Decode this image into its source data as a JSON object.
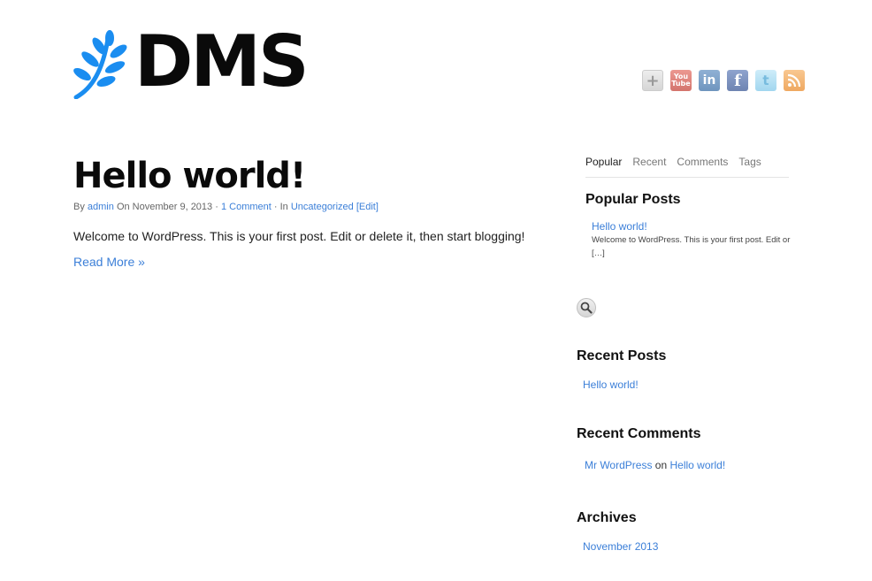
{
  "site": {
    "logo_text": "DMS"
  },
  "social": {
    "icons": [
      "google-plus-icon",
      "youtube-icon",
      "linkedin-icon",
      "facebook-icon",
      "twitter-icon",
      "rss-icon"
    ],
    "youtube_top": "You",
    "youtube_bottom": "Tube",
    "linkedin_glyph": "in",
    "facebook_glyph": "f",
    "twitter_glyph": "t",
    "plus_glyph": "+"
  },
  "post": {
    "title": "Hello world!",
    "by": "By",
    "author": "admin",
    "on": "On November 9, 2013 ·",
    "comments": "1 Comment",
    "in": "· In",
    "category": "Uncategorized",
    "edit": "[Edit]",
    "excerpt": "Welcome to WordPress. This is your first post. Edit or delete it, then start blogging!",
    "read_more": "Read More »"
  },
  "sidebar": {
    "tabs": [
      "Popular",
      "Recent",
      "Comments",
      "Tags"
    ],
    "popular_title": "Popular Posts",
    "popular_link": "Hello world!",
    "popular_excerpt": "Welcome to WordPress. This is your first post. Edit or […]",
    "recent_posts_title": "Recent Posts",
    "recent_post_link": "Hello world!",
    "recent_comments_title": "Recent Comments",
    "comment_author": "Mr WordPress",
    "comment_on": "on",
    "comment_post": "Hello world!",
    "archives_title": "Archives",
    "archive_link": "November 2013"
  },
  "colors": {
    "accent": "#3b7fd8",
    "logo_leaf": "#1a8df0"
  }
}
